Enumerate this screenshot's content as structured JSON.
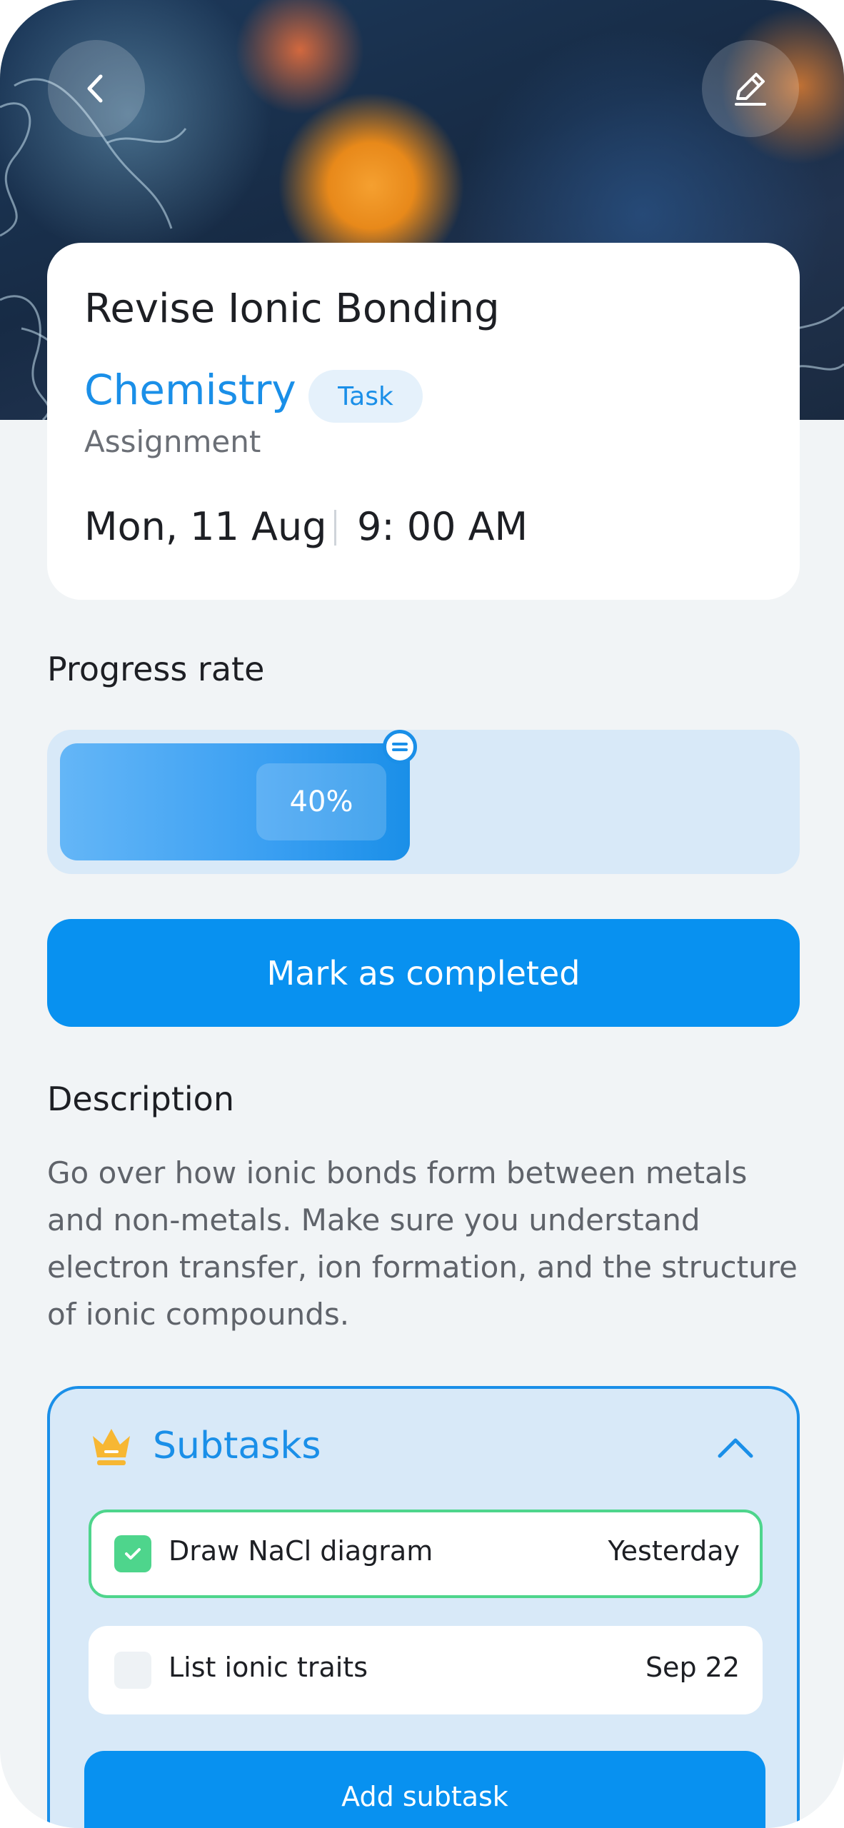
{
  "header": {
    "back_icon": "chevron-left-icon",
    "edit_icon": "pencil-icon"
  },
  "task": {
    "title": "Revise Ionic Bonding",
    "subject": "Chemistry",
    "tag": "Task",
    "type": "Assignment",
    "date": "Mon, 11 Aug",
    "time": "9: 00 AM"
  },
  "progress": {
    "title": "Progress rate",
    "value": 40,
    "label": "40%"
  },
  "actions": {
    "complete_label": "Mark as completed"
  },
  "description": {
    "title": "Description",
    "text": "Go over how ionic bonds form between metals and non-metals. Make sure you understand electron transfer, ion formation, and the structure of ionic compounds."
  },
  "subtasks": {
    "title": "Subtasks",
    "icon": "crown-icon",
    "items": [
      {
        "label": "Draw NaCl diagram",
        "date": "Yesterday",
        "done": true
      },
      {
        "label": "List ionic traits",
        "date": "Sep 22",
        "done": false
      }
    ],
    "add_label": "Add subtask"
  },
  "colors": {
    "accent": "#1a8fe8",
    "button": "#0891f0",
    "success": "#4ed58c",
    "background": "#f1f4f6"
  }
}
